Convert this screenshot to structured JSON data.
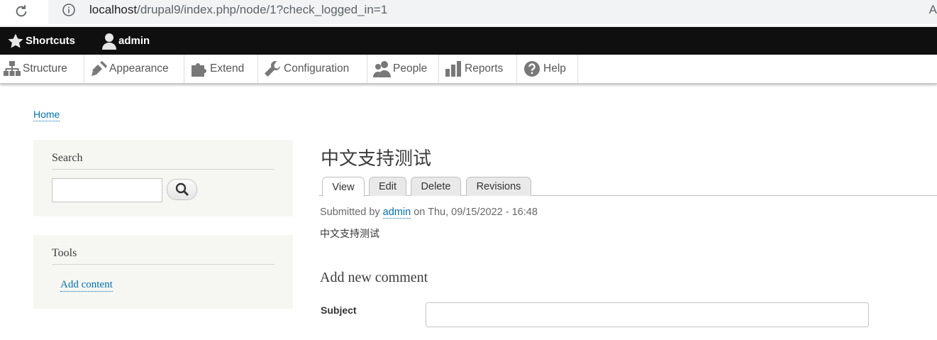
{
  "browser": {
    "url_host": "localhost",
    "url_path": "/drupal9/index.php/node/1?check_logged_in=1",
    "right_glyph": "A"
  },
  "toolbar": {
    "shortcuts_label": "Shortcuts",
    "user_label": "admin"
  },
  "admin_menu": [
    {
      "label": "Structure",
      "icon": "sitemap-icon"
    },
    {
      "label": "Appearance",
      "icon": "paintbrush-icon"
    },
    {
      "label": "Extend",
      "icon": "puzzle-icon"
    },
    {
      "label": "Configuration",
      "icon": "wrench-icon"
    },
    {
      "label": "People",
      "icon": "people-icon"
    },
    {
      "label": "Reports",
      "icon": "bar-chart-icon"
    },
    {
      "label": "Help",
      "icon": "help-icon"
    }
  ],
  "breadcrumb": {
    "home": "Home"
  },
  "sidebar": {
    "search": {
      "title": "Search",
      "button_icon": "search-icon"
    },
    "tools": {
      "title": "Tools",
      "link": "Add content"
    }
  },
  "node": {
    "title": "中文支持测试",
    "tabs": [
      "View",
      "Edit",
      "Delete",
      "Revisions"
    ],
    "active_tab": "View",
    "submitted_prefix": "Submitted by",
    "author": "admin",
    "submitted_suffix": "on Thu, 09/15/2022 - 16:48",
    "body": "中文支持测试"
  },
  "comment": {
    "title": "Add new comment",
    "subject_label": "Subject"
  },
  "colors": {
    "link": "#0071b3",
    "toolbar_bg": "#0f0f0f",
    "block_bg": "#f6f6f2"
  }
}
